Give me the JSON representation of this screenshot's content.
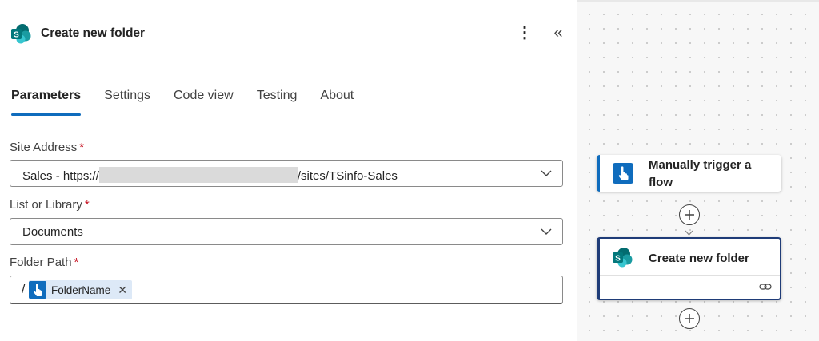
{
  "panel": {
    "title": "Create new folder",
    "more_label": "⋮",
    "collapse_label": "«"
  },
  "tabs": [
    {
      "label": "Parameters",
      "active": true
    },
    {
      "label": "Settings",
      "active": false
    },
    {
      "label": "Code view",
      "active": false
    },
    {
      "label": "Testing",
      "active": false
    },
    {
      "label": "About",
      "active": false
    }
  ],
  "fields": {
    "site_address": {
      "label": "Site Address",
      "required_mark": "*",
      "value_prefix": "Sales - https://",
      "value_suffix": "/sites/TSinfo-Sales"
    },
    "list_or_library": {
      "label": "List or Library",
      "required_mark": "*",
      "value": "Documents"
    },
    "folder_path": {
      "label": "Folder Path",
      "required_mark": "*",
      "prefix": "/",
      "token_label": "FolderName",
      "token_remove": "✕"
    }
  },
  "canvas": {
    "trigger_card": {
      "title_line1": "Manually trigger a",
      "title_line2": "flow",
      "icon": "manual-trigger-icon"
    },
    "action_card": {
      "title": "Create new folder",
      "icon": "sharepoint-icon",
      "link_icon": "link-icon"
    }
  },
  "colors": {
    "accent": "#0f6cbd",
    "required": "#c50f1f",
    "token_bg": "#dde9f7",
    "selected_card_border": "#1f3c78",
    "sharepoint_teal": "#038387"
  }
}
